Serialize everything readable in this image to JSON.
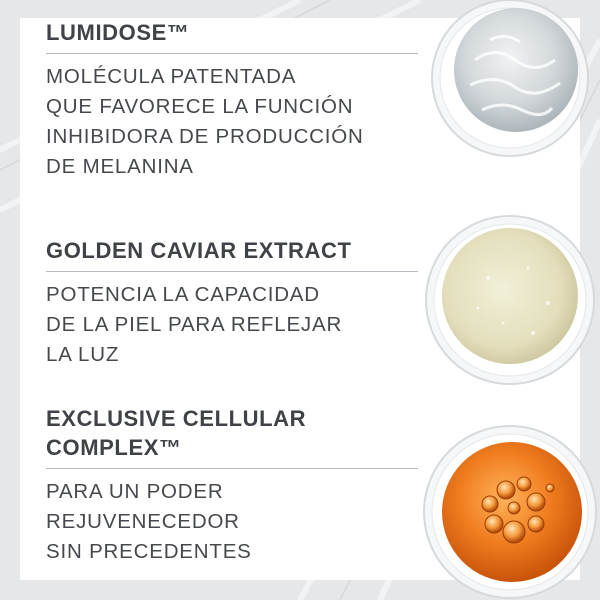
{
  "ingredients": [
    {
      "title": "LUMIDOSE™",
      "description": [
        "MOLÉCULA PATENTADA",
        "QUE FAVORECE LA FUNCIÓN",
        "INHIBIDORA DE PRODUCCIÓN",
        "DE MELANINA"
      ],
      "swatch": "clear-gel",
      "color": "#c9d0d4"
    },
    {
      "title": "GOLDEN CAVIAR EXTRACT",
      "description": [
        "POTENCIA LA CAPACIDAD",
        "DE LA PIEL PARA REFLEJAR",
        "LA LUZ"
      ],
      "swatch": "golden-gel",
      "color": "#e4e0c0"
    },
    {
      "title_lines": [
        "EXCLUSIVE CELLULAR",
        "COMPLEX™"
      ],
      "description": [
        "PARA UN PODER",
        "REJUVENECEDOR",
        "SIN PRECEDENTES"
      ],
      "swatch": "orange-serum",
      "color": "#ee7a1f"
    }
  ]
}
